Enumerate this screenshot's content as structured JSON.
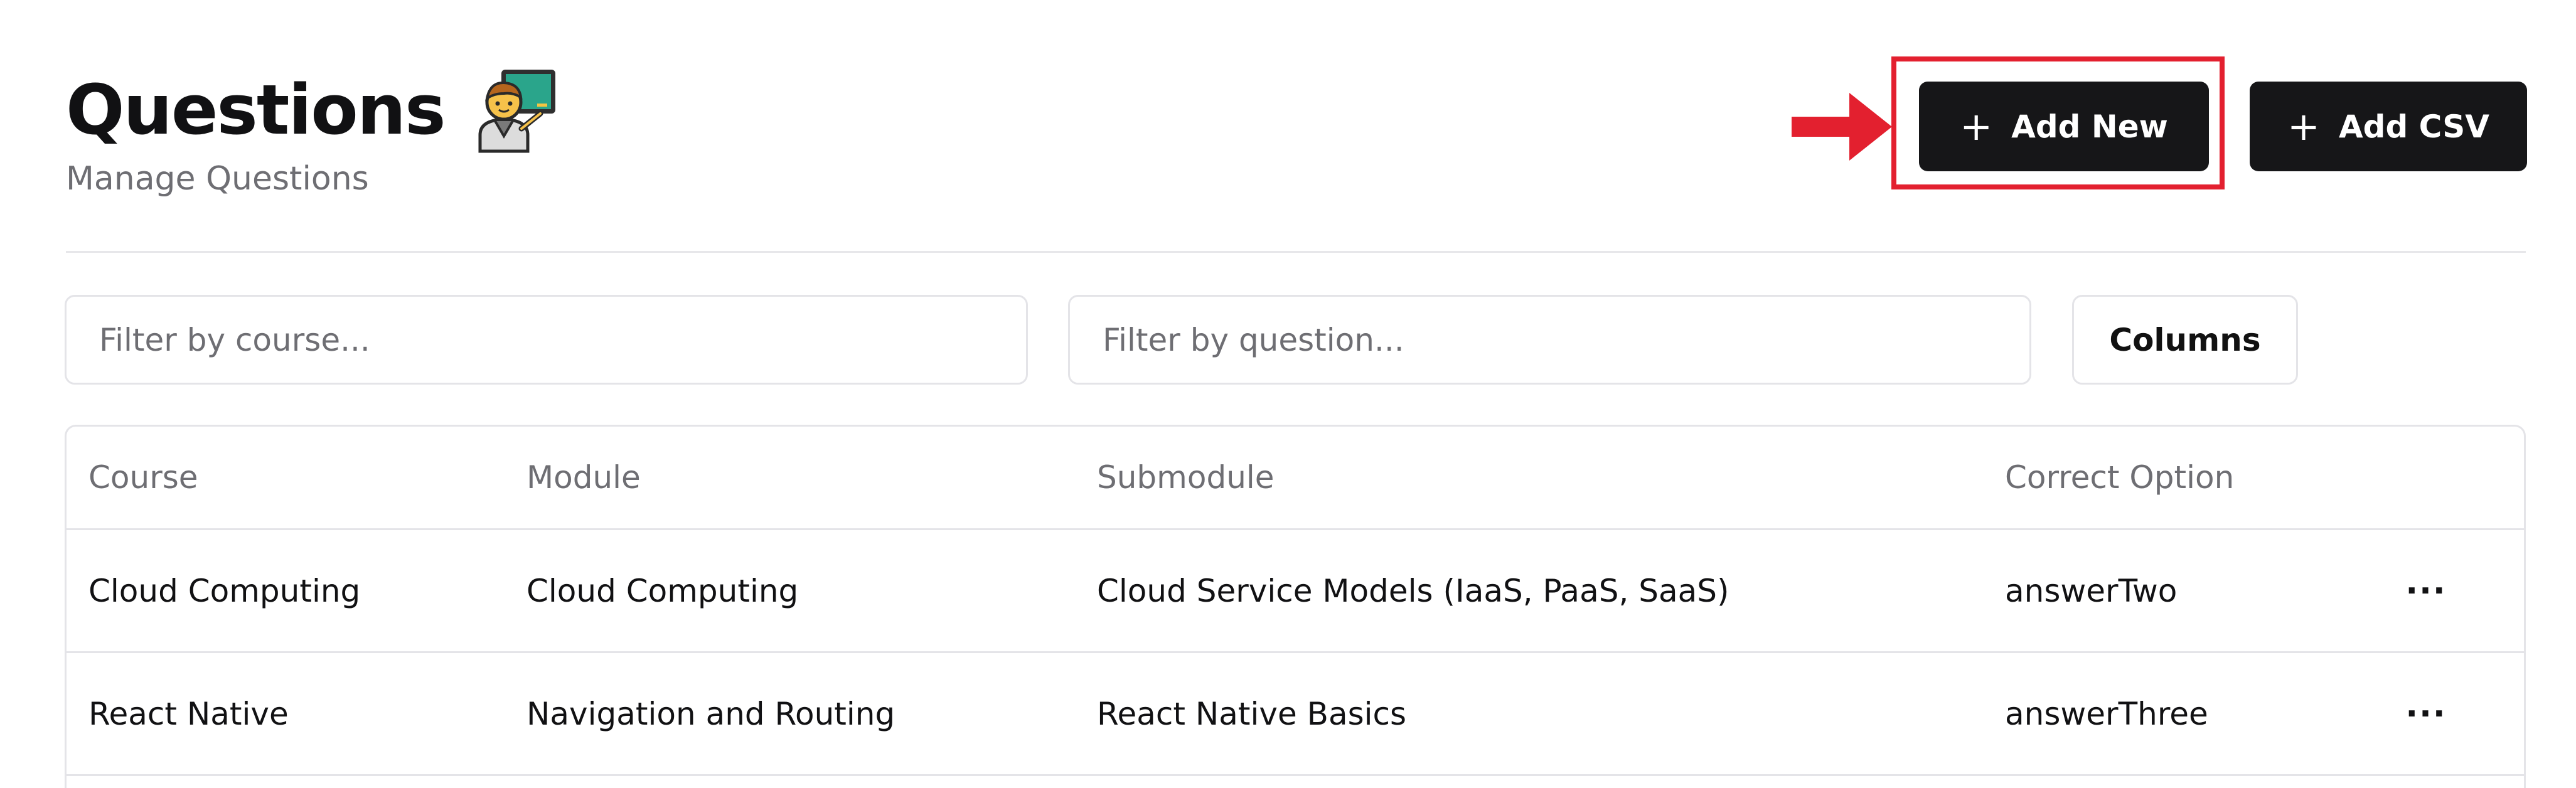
{
  "header": {
    "title": "Questions",
    "subtitle": "Manage Questions",
    "title_icon": "teacher-emoji-icon"
  },
  "actions": {
    "add_new_label": "Add New",
    "add_csv_label": "Add CSV",
    "plus_glyph": "+"
  },
  "filters": {
    "course_placeholder": "Filter by course...",
    "question_placeholder": "Filter by question...",
    "columns_label": "Columns"
  },
  "table": {
    "columns": [
      "Course",
      "Module",
      "Submodule",
      "Correct Option"
    ],
    "rows": [
      {
        "course": "Cloud Computing",
        "module": "Cloud Computing",
        "submodule": "Cloud Service Models (IaaS, PaaS, SaaS)",
        "correct_option": "answerTwo",
        "actions": "···"
      },
      {
        "course": "React Native",
        "module": "Navigation and Routing",
        "submodule": "React Native Basics",
        "correct_option": "answerThree",
        "actions": "···"
      }
    ]
  },
  "colors": {
    "button_bg": "#161618",
    "highlight": "#e3202f",
    "border": "#e4e4e8",
    "muted_text": "#6e6e73"
  }
}
